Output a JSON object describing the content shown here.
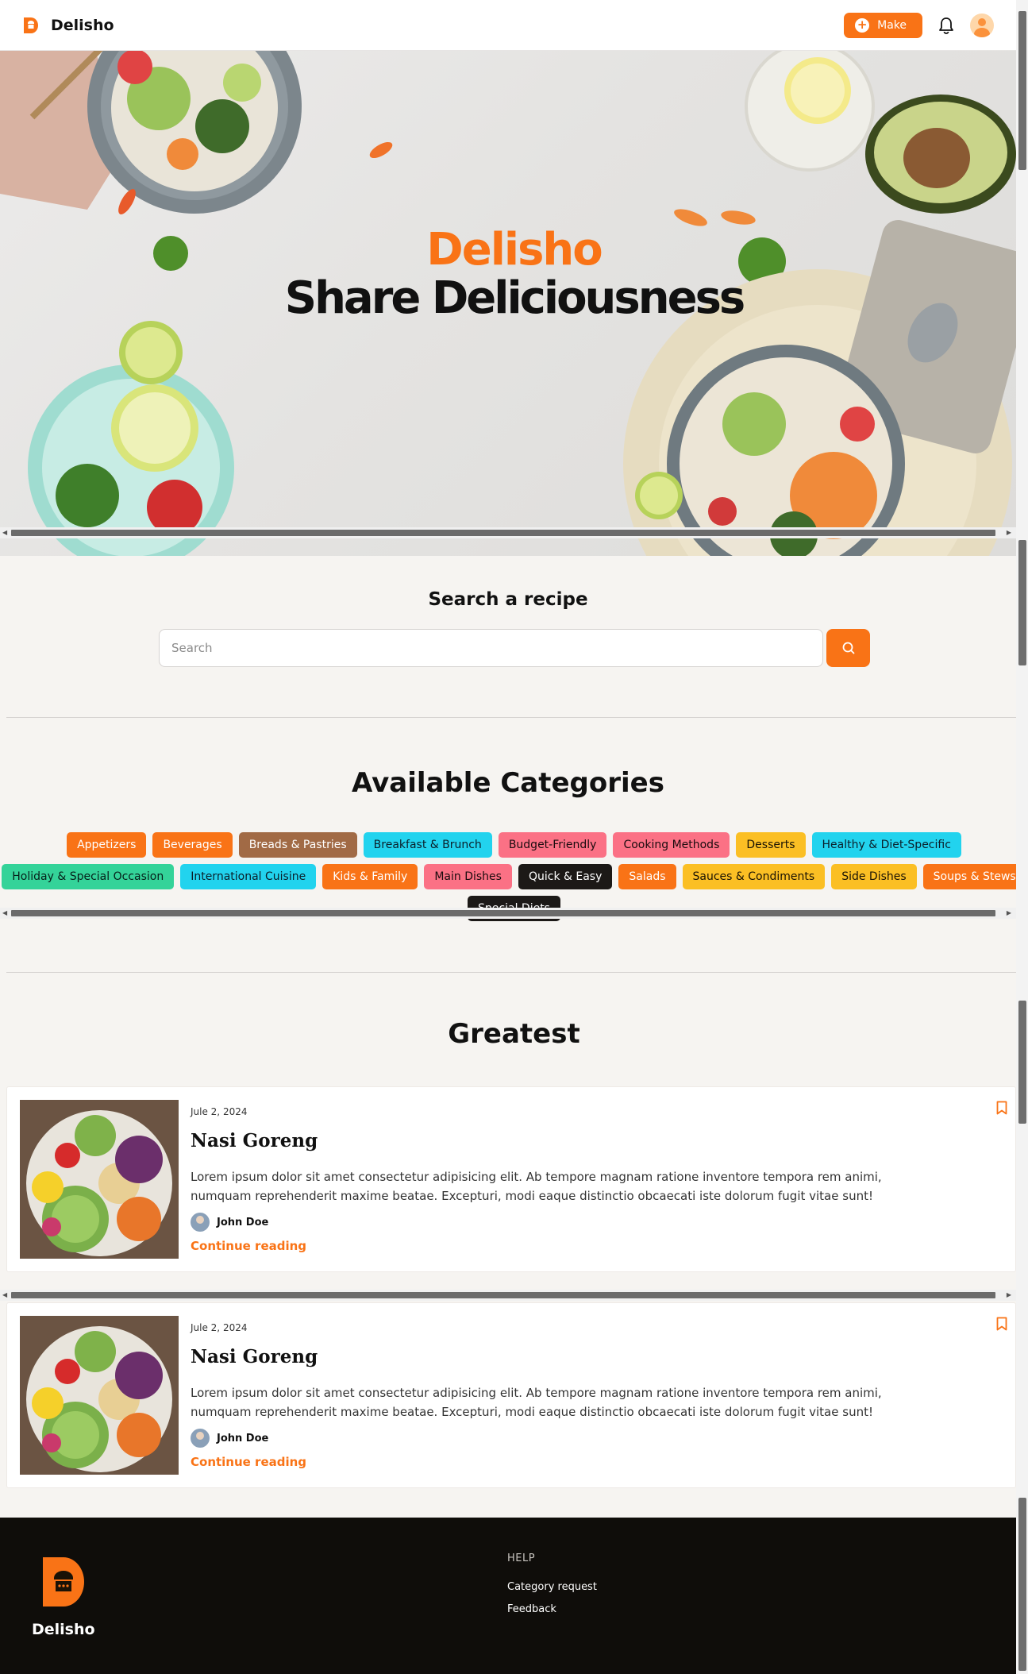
{
  "header": {
    "brand": "Delisho",
    "make_label": "Make"
  },
  "hero": {
    "title": "Delisho",
    "subtitle": "Share Deliciousness"
  },
  "search": {
    "title": "Search a recipe",
    "placeholder": "Search"
  },
  "categories": {
    "title": "Available Categories",
    "rows": [
      [
        {
          "label": "Appetizers",
          "bg": "#f97316",
          "fg": "#ffffff"
        },
        {
          "label": "Beverages",
          "bg": "#f97316",
          "fg": "#ffffff"
        },
        {
          "label": "Breads & Pastries",
          "bg": "#a16a45",
          "fg": "#ffffff"
        },
        {
          "label": "Breakfast & Brunch",
          "bg": "#22d3ee",
          "fg": "#0b1f2a"
        },
        {
          "label": "Budget-Friendly",
          "bg": "#fb7185",
          "fg": "#1a0b0e"
        },
        {
          "label": "Cooking Methods",
          "bg": "#fb7185",
          "fg": "#1a0b0e"
        },
        {
          "label": "Desserts",
          "bg": "#fbbf24",
          "fg": "#1a1304"
        },
        {
          "label": "Healthy & Diet-Specific",
          "bg": "#22d3ee",
          "fg": "#0b1f2a"
        }
      ],
      [
        {
          "label": "Holiday & Special Occasion",
          "bg": "#34d399",
          "fg": "#06201a"
        },
        {
          "label": "International Cuisine",
          "bg": "#22d3ee",
          "fg": "#0b1f2a"
        },
        {
          "label": "Kids & Family",
          "bg": "#f97316",
          "fg": "#ffffff"
        },
        {
          "label": "Main Dishes",
          "bg": "#fb7185",
          "fg": "#1a0b0e"
        },
        {
          "label": "Quick & Easy",
          "bg": "#1c1917",
          "fg": "#ffffff"
        },
        {
          "label": "Salads",
          "bg": "#f97316",
          "fg": "#ffffff"
        },
        {
          "label": "Sauces & Condiments",
          "bg": "#fbbf24",
          "fg": "#1a1304"
        },
        {
          "label": "Side Dishes",
          "bg": "#fbbf24",
          "fg": "#1a1304"
        },
        {
          "label": "Soups & Stews",
          "bg": "#f97316",
          "fg": "#ffffff"
        }
      ],
      [
        {
          "label": "Special Diets",
          "bg": "#1c1917",
          "fg": "#ffffff"
        }
      ]
    ]
  },
  "greatest": {
    "title": "Greatest",
    "posts": [
      {
        "date": "Jule 2, 2024",
        "title": "Nasi Goreng",
        "text": "Lorem ipsum dolor sit amet consectetur adipisicing elit. Ab tempore magnam ratione inventore tempora rem animi, numquam reprehenderit maxime beatae. Excepturi, modi eaque distinctio obcaecati iste dolorum fugit vitae sunt!",
        "author": "John Doe",
        "more": "Continue reading"
      },
      {
        "date": "Jule 2, 2024",
        "title": "Nasi Goreng",
        "text": "Lorem ipsum dolor sit amet consectetur adipisicing elit. Ab tempore magnam ratione inventore tempora rem animi, numquam reprehenderit maxime beatae. Excepturi, modi eaque distinctio obcaecati iste dolorum fugit vitae sunt!",
        "author": "John Doe",
        "more": "Continue reading"
      }
    ]
  },
  "footer": {
    "brand": "Delisho",
    "help_heading": "HELP",
    "links": [
      "Category request",
      "Feedback"
    ]
  },
  "colors": {
    "accent": "#f97316",
    "footer_bg": "#0f0d0a",
    "page_bg": "#f6f4f1"
  }
}
